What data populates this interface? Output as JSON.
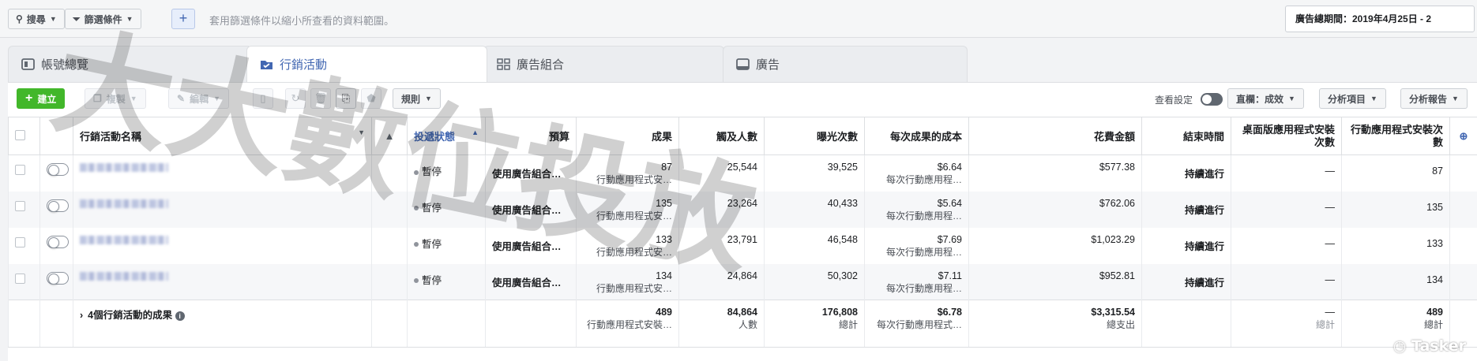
{
  "topbar": {
    "search_label": "搜尋",
    "filter_label": "篩選條件",
    "add_label": "+",
    "hint": "套用篩選條件以縮小所查看的資料範圍。",
    "date_range": "廣告總期間：2019年4月25日 - 2"
  },
  "tabs": [
    {
      "label": "帳號總覽"
    },
    {
      "label": "行銷活動"
    },
    {
      "label": "廣告組合"
    },
    {
      "label": "廣告"
    }
  ],
  "toolbar": {
    "create_label": "建立",
    "copy_label": "複製",
    "edit_label": "編輯",
    "rules_label": "規則",
    "view_settings_label": "查看設定",
    "columns_label": "直欄：成效",
    "breakdown_label": "分析項目",
    "reports_label": "分析報告"
  },
  "table": {
    "headers": {
      "name": "行銷活動名稱",
      "delivery": "投遞狀態",
      "budget": "預算",
      "results": "成果",
      "reach": "觸及人數",
      "impressions": "曝光次數",
      "cost_per_result": "每次成果的成本",
      "amount_spent": "花費金額",
      "ends": "結束時間",
      "desktop_installs": "桌面版應用程式安裝次數",
      "mobile_installs": "行動應用程式安裝次數"
    },
    "rows": [
      {
        "status": "暫停",
        "budget": "使用廣告組合…",
        "results": "87",
        "results_sub": "行動應用程式安…",
        "reach": "25,544",
        "impressions": "39,525",
        "cpr": "$6.64",
        "cpr_sub": "每次行動應用程…",
        "spent": "$577.38",
        "ends": "持續進行",
        "desktop": "—",
        "mobile": "87"
      },
      {
        "status": "暫停",
        "budget": "使用廣告組合…",
        "results": "135",
        "results_sub": "行動應用程式安…",
        "reach": "23,264",
        "impressions": "40,433",
        "cpr": "$5.64",
        "cpr_sub": "每次行動應用程…",
        "spent": "$762.06",
        "ends": "持續進行",
        "desktop": "—",
        "mobile": "135"
      },
      {
        "status": "暫停",
        "budget": "使用廣告組合…",
        "results": "133",
        "results_sub": "行動應用程式安…",
        "reach": "23,791",
        "impressions": "46,548",
        "cpr": "$7.69",
        "cpr_sub": "每次行動應用程…",
        "spent": "$1,023.29",
        "ends": "持續進行",
        "desktop": "—",
        "mobile": "133"
      },
      {
        "status": "暫停",
        "budget": "使用廣告組合…",
        "results": "134",
        "results_sub": "行動應用程式安…",
        "reach": "24,864",
        "impressions": "50,302",
        "cpr": "$7.11",
        "cpr_sub": "每次行動應用程…",
        "spent": "$952.81",
        "ends": "持續進行",
        "desktop": "—",
        "mobile": "134"
      }
    ],
    "summary": {
      "label": "4個行銷活動的成果",
      "results": "489",
      "results_sub": "行動應用程式安裝…",
      "reach": "84,864",
      "reach_sub": "人數",
      "impressions": "176,808",
      "impressions_sub": "總計",
      "cpr": "$6.78",
      "cpr_sub": "每次行動應用程式…",
      "spent": "$3,315.54",
      "spent_sub": "總支出",
      "desktop": "—",
      "desktop_sub": "總計",
      "mobile": "489",
      "mobile_sub": "總計"
    }
  },
  "watermark": {
    "text": "大大數位投放",
    "brand": "Tasker"
  }
}
